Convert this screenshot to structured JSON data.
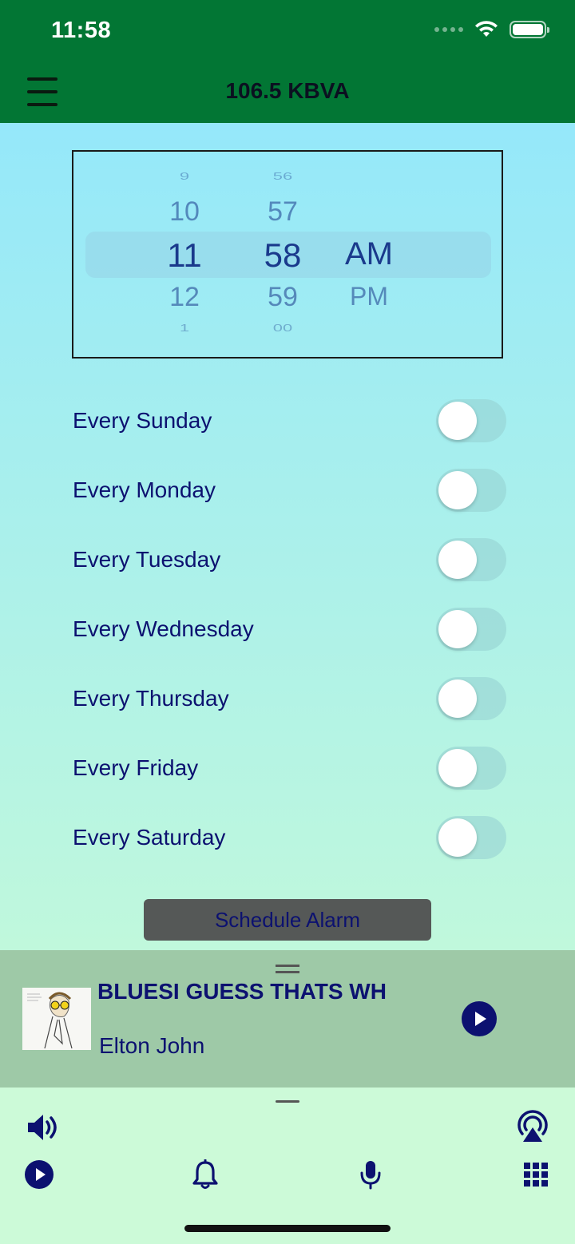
{
  "status_bar": {
    "time": "11:58"
  },
  "nav": {
    "title": "106.5 KBVA"
  },
  "picker": {
    "hours": [
      "9",
      "10",
      "11",
      "12",
      "1"
    ],
    "minutes": [
      "56",
      "57",
      "58",
      "59",
      "00"
    ],
    "periods": [
      "AM",
      "PM"
    ],
    "selected": {
      "hour": "11",
      "minute": "58",
      "period": "AM"
    }
  },
  "alarm_days": [
    {
      "label": "Every Sunday",
      "enabled": false
    },
    {
      "label": "Every Monday",
      "enabled": false
    },
    {
      "label": "Every Tuesday",
      "enabled": false
    },
    {
      "label": "Every Wednesday",
      "enabled": false
    },
    {
      "label": "Every Thursday",
      "enabled": false
    },
    {
      "label": "Every Friday",
      "enabled": false
    },
    {
      "label": "Every Saturday",
      "enabled": false
    }
  ],
  "schedule_button": "Schedule Alarm",
  "now_playing": {
    "title": "BLUESI GUESS THATS WH",
    "artist": "Elton John"
  },
  "icons": {
    "volume": "speaker-icon",
    "airplay": "airplay-icon",
    "play": "play-icon",
    "alarm": "bell-icon",
    "mic": "microphone-icon",
    "grid": "grid-icon"
  },
  "colors": {
    "header": "#027634",
    "accent": "#0c1170"
  }
}
